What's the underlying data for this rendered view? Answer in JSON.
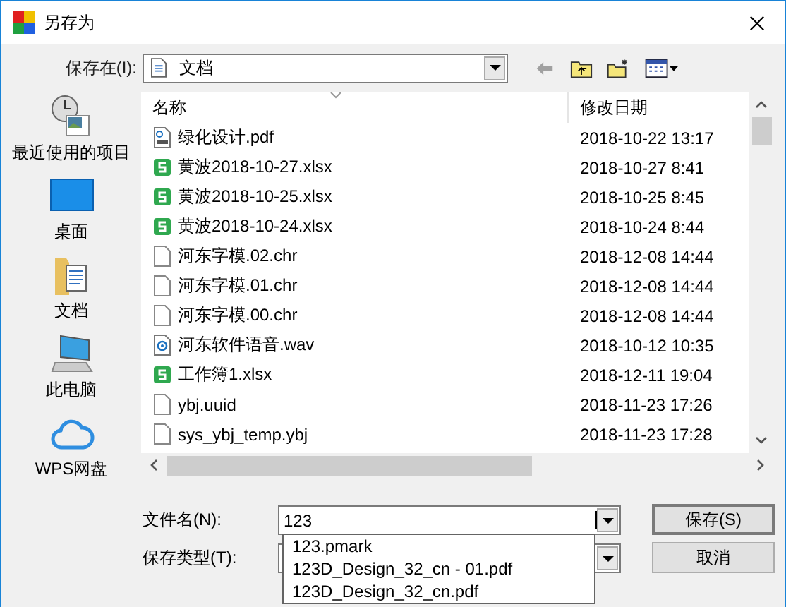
{
  "window": {
    "title": "另存为"
  },
  "location": {
    "label": "保存在(I):",
    "value": "文档"
  },
  "places": [
    {
      "kind": "recent",
      "label": "最近使用的项目"
    },
    {
      "kind": "desktop",
      "label": "桌面"
    },
    {
      "kind": "documents",
      "label": "文档"
    },
    {
      "kind": "computer",
      "label": "此电脑"
    },
    {
      "kind": "cloud",
      "label": "WPS网盘"
    }
  ],
  "table": {
    "columns": [
      "名称",
      "修改日期"
    ],
    "rows": [
      {
        "kind": "pdf",
        "name": "绿化设计.pdf",
        "modified": "2018-10-22 13:17"
      },
      {
        "kind": "sheet",
        "name": "黄波2018-10-27.xlsx",
        "modified": "2018-10-27 8:41"
      },
      {
        "kind": "sheet",
        "name": "黄波2018-10-25.xlsx",
        "modified": "2018-10-25 8:45"
      },
      {
        "kind": "sheet",
        "name": "黄波2018-10-24.xlsx",
        "modified": "2018-10-24 8:44"
      },
      {
        "kind": "blank",
        "name": "河东字模.02.chr",
        "modified": "2018-12-08 14:44"
      },
      {
        "kind": "blank",
        "name": "河东字模.01.chr",
        "modified": "2018-12-08 14:44"
      },
      {
        "kind": "blank",
        "name": "河东字模.00.chr",
        "modified": "2018-12-08 14:44"
      },
      {
        "kind": "audio",
        "name": "河东软件语音.wav",
        "modified": "2018-10-12 10:35"
      },
      {
        "kind": "sheet",
        "name": "工作簿1.xlsx",
        "modified": "2018-12-11 19:04"
      },
      {
        "kind": "blank",
        "name": "ybj.uuid",
        "modified": "2018-11-23 17:26"
      },
      {
        "kind": "blank",
        "name": "sys_ybj_temp.ybj",
        "modified": "2018-11-23 17:28"
      }
    ]
  },
  "file_name": {
    "label": "文件名(N):",
    "value": "123"
  },
  "file_type": {
    "label": "保存类型(T):"
  },
  "suggestions": [
    "123.pmark",
    "123D_Design_32_cn - 01.pdf",
    "123D_Design_32_cn.pdf"
  ],
  "buttons": [
    "保存(S)",
    "取消"
  ]
}
